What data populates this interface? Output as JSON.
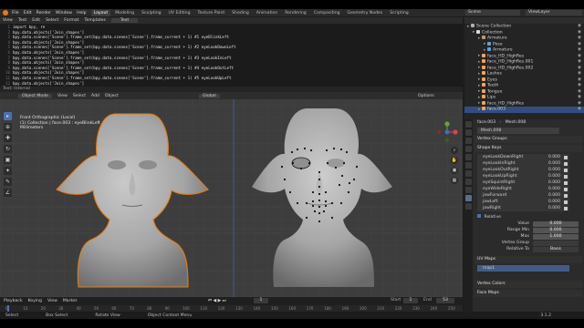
{
  "topbar": {
    "menus": [
      "File",
      "Edit",
      "Render",
      "Window",
      "Help"
    ],
    "workspaces": [
      "Layout",
      "Modeling",
      "Sculpting",
      "UV Editing",
      "Texture Paint",
      "Shading",
      "Animation",
      "Rendering",
      "Compositing",
      "Geometry Nodes",
      "Scripting"
    ],
    "active_workspace": "Layout",
    "scene": "Scene",
    "view_layer": "ViewLayer"
  },
  "text_editor": {
    "menus": [
      "View",
      "Text",
      "Edit",
      "Select",
      "Format",
      "Templates"
    ],
    "filename": "Text",
    "lines": [
      {
        "n": "1",
        "text": "import bpy, re"
      },
      {
        "n": "2",
        "text": "bpy.data.objects['Join_shapes']"
      },
      {
        "n": "3",
        "text": "bpy.data.scenes['Scene'].frame_set(bpy.data.scenes['Scene'].frame_current + 1) #1 eyeBlinkLeft"
      },
      {
        "n": "4",
        "text": "bpy.data.objects['Join_shapes']"
      },
      {
        "n": "5",
        "text": "bpy.data.scenes['Scene'].frame_set(bpy.data.scenes['Scene'].frame_current + 1) #2 eyeLookDownLeft"
      },
      {
        "n": "6",
        "text": "bpy.data.objects['Join_shapes']"
      },
      {
        "n": "7",
        "text": "bpy.data.scenes['Scene'].frame_set(bpy.data.scenes['Scene'].frame_current + 1) #3 eyeLookInLeft"
      },
      {
        "n": "8",
        "text": "bpy.data.objects['Join_shapes']"
      },
      {
        "n": "9",
        "text": "bpy.data.scenes['Scene'].frame_set(bpy.data.scenes['Scene'].frame_current + 1) #4 eyeLookOutLeft"
      },
      {
        "n": "10",
        "text": "bpy.data.objects['Join_shapes']"
      },
      {
        "n": "11",
        "text": "bpy.data.scenes['Scene'].frame_set(bpy.data.scenes['Scene'].frame_current + 1) #5 eyeLookUpLeft"
      },
      {
        "n": "12",
        "text": "bpy.data.objects['Join_shapes']"
      }
    ],
    "footer": "Text: Internal"
  },
  "viewport": {
    "mode": "Object Mode",
    "menus": [
      "View",
      "Select",
      "Add",
      "Object"
    ],
    "transform": "Global",
    "options": "Options",
    "overlay_lines": [
      "Front Orthographic (Local)",
      "(1) Collection | face.003 : eyeBlinkLeft",
      "Millimeters"
    ],
    "tools": [
      "select",
      "cursor",
      "move",
      "rotate",
      "scale",
      "transform",
      "annotate",
      "measure"
    ]
  },
  "timeline": {
    "menus": [
      "Playback",
      "Keying",
      "View",
      "Marker"
    ],
    "current_frame": "1",
    "start_label": "Start",
    "start": "1",
    "end_label": "End",
    "end": "53",
    "ticks": [
      "0",
      "10",
      "20",
      "30",
      "40",
      "50",
      "60",
      "70",
      "80",
      "90",
      "100",
      "110",
      "120",
      "130",
      "140",
      "150",
      "160",
      "170",
      "180",
      "190",
      "200",
      "210",
      "220",
      "230",
      "240",
      "250"
    ]
  },
  "outliner": {
    "rows": [
      {
        "indent": 0,
        "label": "Scene Collection",
        "color": "#b0b0b0",
        "sel": false
      },
      {
        "indent": 1,
        "label": "Collection",
        "color": "#dddddd",
        "sel": false
      },
      {
        "indent": 2,
        "label": "Armature",
        "color": "#c49a6c",
        "sel": false
      },
      {
        "indent": 3,
        "label": "Pose",
        "color": "#5fa2d6",
        "sel": false
      },
      {
        "indent": 3,
        "label": "Armature",
        "color": "#5fa2d6",
        "sel": false
      },
      {
        "indent": 2,
        "label": "face_HD_HighRes",
        "color": "#f0a45d",
        "sel": false
      },
      {
        "indent": 2,
        "label": "face_HD_HighRes.001",
        "color": "#f0a45d",
        "sel": false
      },
      {
        "indent": 2,
        "label": "face_HD_HighRes.002",
        "color": "#f0a45d",
        "sel": false
      },
      {
        "indent": 2,
        "label": "Lashes",
        "color": "#f0a45d",
        "sel": false
      },
      {
        "indent": 2,
        "label": "Eyes",
        "color": "#f0a45d",
        "sel": false
      },
      {
        "indent": 2,
        "label": "Teeth",
        "color": "#f0a45d",
        "sel": false
      },
      {
        "indent": 2,
        "label": "Tongue",
        "color": "#f0a45d",
        "sel": false
      },
      {
        "indent": 2,
        "label": "Lips",
        "color": "#f0a45d",
        "sel": false
      },
      {
        "indent": 2,
        "label": "face_HD_HighRes",
        "color": "#f0a45d",
        "sel": false
      },
      {
        "indent": 2,
        "label": "face.003",
        "color": "#f0a45d",
        "sel": true
      }
    ]
  },
  "properties": {
    "object_name": "face.003",
    "mesh_name": "Mesh.008",
    "vertex_groups": "Vertex Groups",
    "shape_keys_title": "Shape Keys",
    "shape_keys": [
      {
        "name": "eyeLookDownRight",
        "value": "0.000",
        "sel": false
      },
      {
        "name": "eyeLookInRight",
        "value": "0.000",
        "sel": false
      },
      {
        "name": "eyeLookOutRight",
        "value": "0.000",
        "sel": false
      },
      {
        "name": "eyeLookUpRight",
        "value": "0.000",
        "sel": false
      },
      {
        "name": "eyeSquintRight",
        "value": "0.000",
        "sel": false
      },
      {
        "name": "eyeWideRight",
        "value": "0.000",
        "sel": false
      },
      {
        "name": "jawForward",
        "value": "0.000",
        "sel": false
      },
      {
        "name": "jawLeft",
        "value": "0.000",
        "sel": false
      },
      {
        "name": "jawRight",
        "value": "0.000",
        "sel": false
      }
    ],
    "relative_label": "Relative",
    "value_label": "Value",
    "value": "0.000",
    "range_min_label": "Range Min",
    "range_min": "0.000",
    "max_label": "Max",
    "max": "1.000",
    "vertex_group_label": "Vertex Group",
    "relative_to_label": "Relative To",
    "relative_to": "Basis",
    "uv_maps_title": "UV Maps",
    "uv_map": "map1",
    "vertex_colors_title": "Vertex Colors",
    "face_maps_title": "Face Maps"
  },
  "statusbar": {
    "select": "Select",
    "box_select": "Box Select",
    "rotate_view": "Rotate View",
    "object_menu": "Object Context Menu",
    "version": "3.1.2"
  },
  "colors": {
    "accent_orange": "#e87d0d",
    "selection_blue": "#4772b3"
  }
}
